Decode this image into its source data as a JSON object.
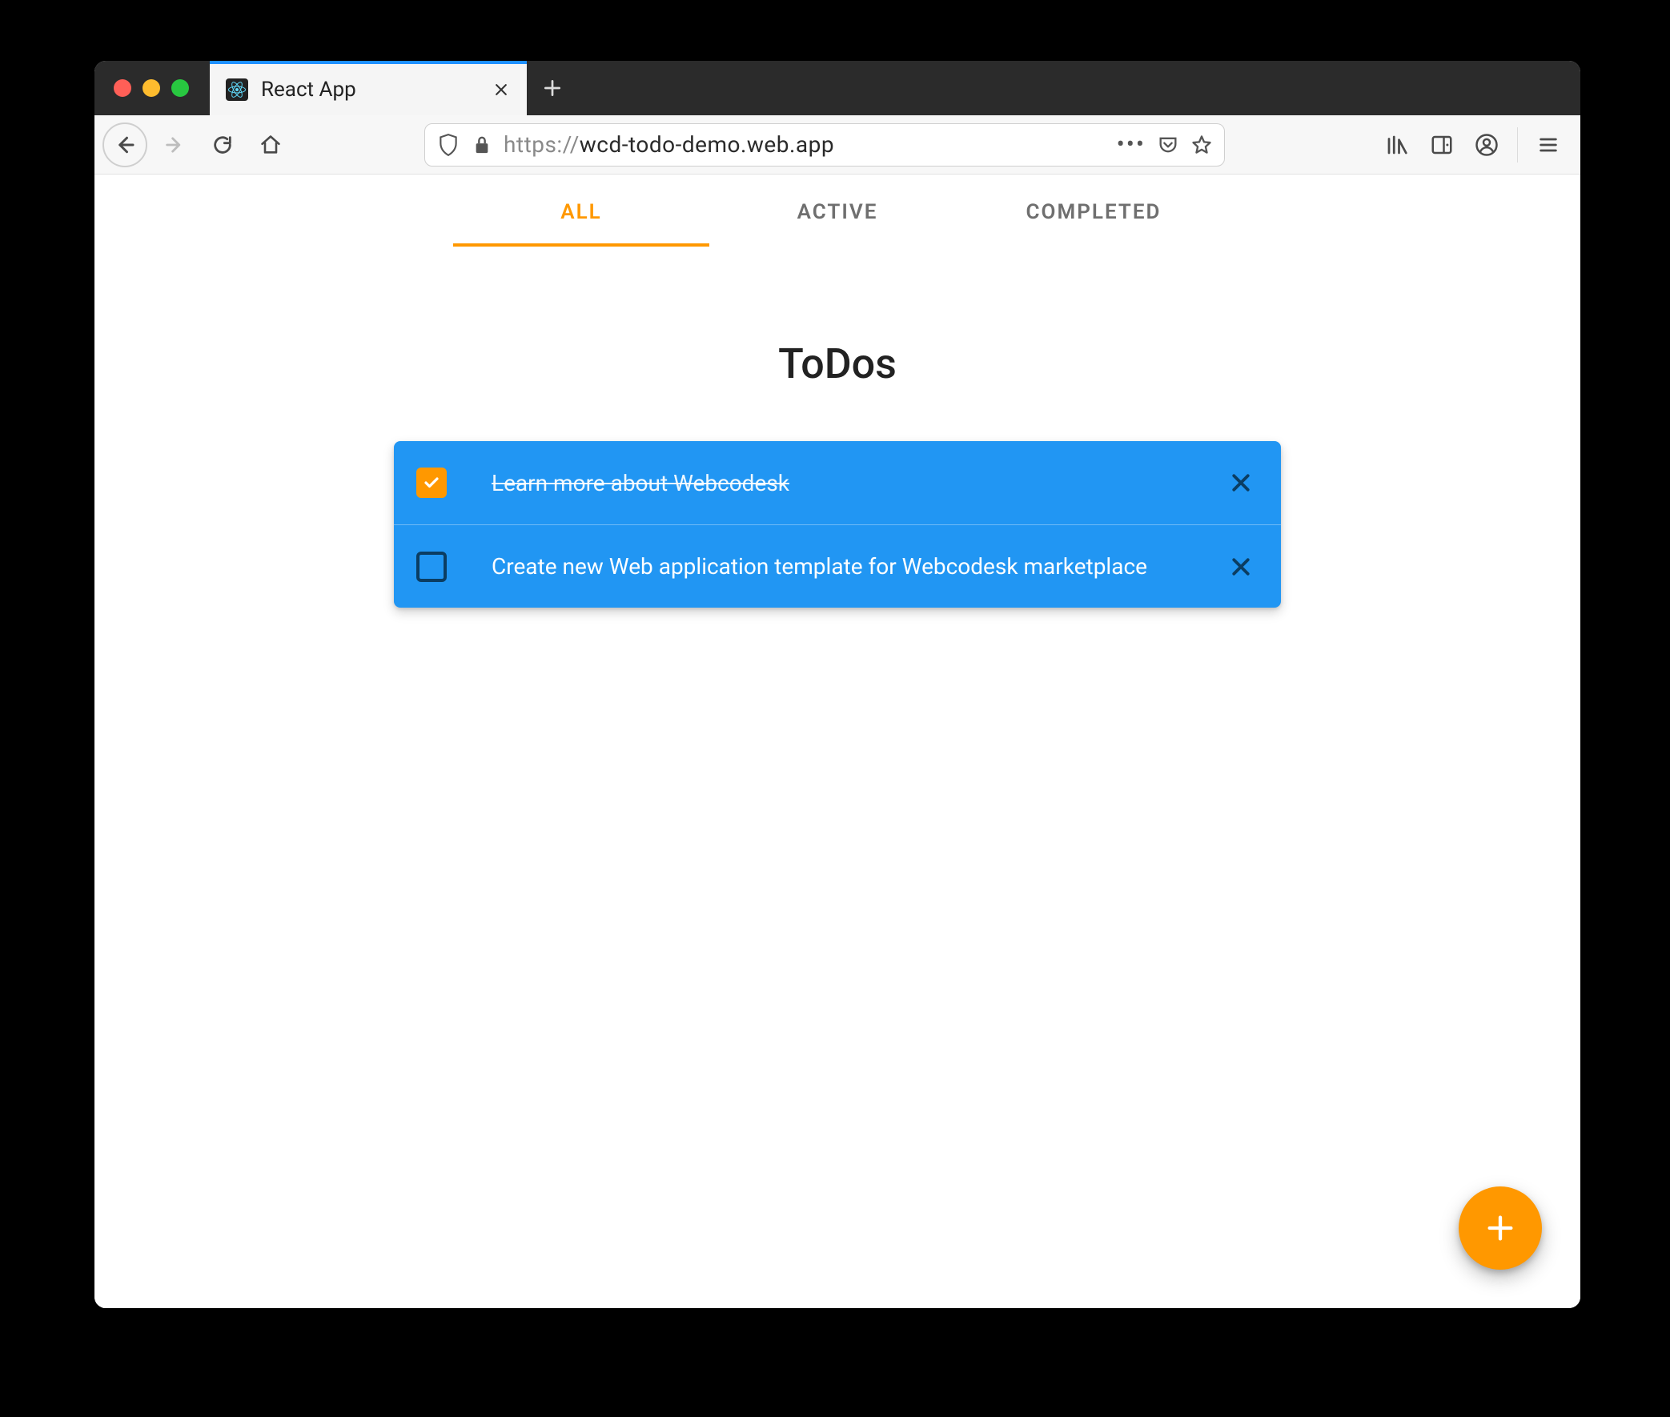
{
  "browser": {
    "tab_title": "React App",
    "url_protocol": "https://",
    "url_host_path": "wcd-todo-demo.web.app"
  },
  "filters": {
    "items": [
      {
        "label": "ALL",
        "active": true
      },
      {
        "label": "ACTIVE",
        "active": false
      },
      {
        "label": "COMPLETED",
        "active": false
      }
    ]
  },
  "page": {
    "title": "ToDos"
  },
  "todos": [
    {
      "text": "Learn more about Webcodesk",
      "done": true
    },
    {
      "text": "Create new Web application template for Webcodesk marketplace",
      "done": false
    }
  ],
  "colors": {
    "accent": "#ff9800",
    "primary": "#2196f3"
  }
}
